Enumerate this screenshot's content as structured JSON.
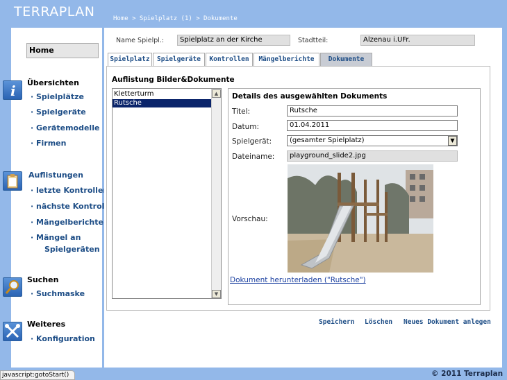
{
  "app": {
    "logo": "TERRAPLAN",
    "breadcrumb": "Home > Spielplatz (1) > Dokumente"
  },
  "sidebar": {
    "home": "Home",
    "sections": [
      {
        "title": "Übersichten",
        "icon": "info-icon",
        "items": [
          "· Spielplätze",
          "· Spielgeräte",
          "· Gerätemodelle",
          "· Firmen"
        ]
      },
      {
        "title": "Auflistungen",
        "icon": "clipboard-icon",
        "items": [
          "· letzte Kontrollen",
          "· nächste Kontrol.",
          "· Mängelberichte",
          "· Mängel an",
          "Spielgeräten"
        ]
      },
      {
        "title": "Suchen",
        "icon": "search-icon",
        "items": [
          "· Suchmaske"
        ]
      },
      {
        "title": "Weiteres",
        "icon": "tools-icon",
        "items": [
          "· Konfiguration"
        ]
      }
    ]
  },
  "header": {
    "name_label": "Name Spielpl.:",
    "name_value": "Spielplatz an der Kirche",
    "district_label": "Stadtteil:",
    "district_value": "Alzenau i.UFr."
  },
  "tabs": [
    "Spielplatz",
    "Spielgeräte",
    "Kontrollen",
    "Mängelberichte",
    "Dokumente"
  ],
  "active_tab": "Dokumente",
  "list": {
    "title": "Auflistung Bilder&Dokumente",
    "items": [
      "Kletterturm",
      "Rutsche"
    ],
    "selected": "Rutsche"
  },
  "details": {
    "title": "Details des ausgewählten Dokuments",
    "titel_label": "Titel:",
    "titel_value": "Rutsche",
    "datum_label": "Datum:",
    "datum_value": "01.04.2011",
    "geraet_label": "Spielgerät:",
    "geraet_value": "(gesamter Spielplatz)",
    "datei_label": "Dateiname:",
    "datei_value": "playground_slide2.jpg",
    "preview_label": "Vorschau:",
    "download_link": "Dokument herunterladen (\"Rutsche\")"
  },
  "actions": {
    "save": "Speichern",
    "delete": "Löschen",
    "new": "Neues Dokument anlegen"
  },
  "footer": {
    "copyright": "© 2011 Terraplan",
    "status": "javascript:gotoStart()"
  }
}
